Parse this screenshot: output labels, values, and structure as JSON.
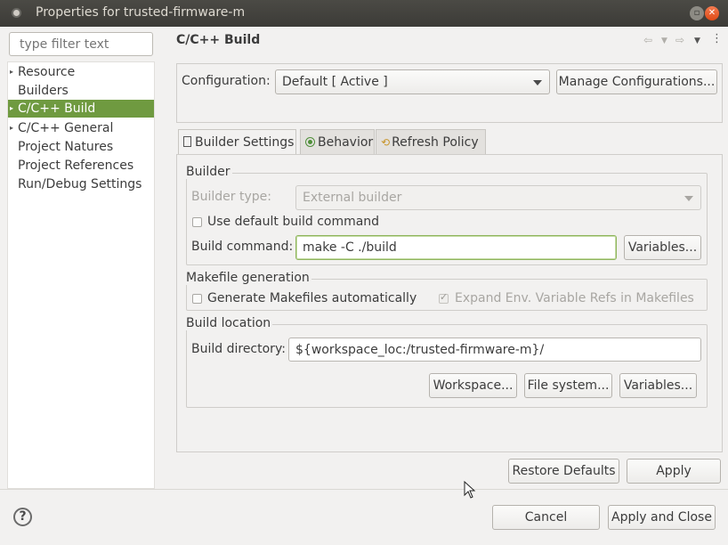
{
  "window": {
    "title": "Properties for trusted-firmware-m"
  },
  "filter": {
    "placeholder": "type filter text"
  },
  "tree": {
    "items": [
      {
        "label": "Resource",
        "expandable": true,
        "selected": false
      },
      {
        "label": "Builders",
        "expandable": false,
        "selected": false
      },
      {
        "label": "C/C++ Build",
        "expandable": true,
        "selected": true
      },
      {
        "label": "C/C++ General",
        "expandable": true,
        "selected": false
      },
      {
        "label": "Project Natures",
        "expandable": false,
        "selected": false
      },
      {
        "label": "Project References",
        "expandable": false,
        "selected": false
      },
      {
        "label": "Run/Debug Settings",
        "expandable": false,
        "selected": false
      }
    ]
  },
  "page": {
    "heading": "C/C++ Build"
  },
  "configuration": {
    "label": "Configuration:",
    "value": "Default  [ Active ]",
    "manage_button": "Manage Configurations..."
  },
  "tabs": [
    {
      "label": "Builder Settings",
      "icon": "document-icon",
      "active": true
    },
    {
      "label": "Behavior",
      "icon": "radio-target-icon",
      "active": false
    },
    {
      "label": "Refresh Policy",
      "icon": "refresh-icon",
      "active": false
    }
  ],
  "builder": {
    "group_label": "Builder",
    "type_label": "Builder type:",
    "type_value": "External builder",
    "use_default_label": "Use default build command",
    "use_default_checked": false,
    "command_label": "Build command:",
    "command_value": "make -C ./build",
    "variables_button": "Variables..."
  },
  "makefile": {
    "group_label": "Makefile generation",
    "generate_label": "Generate Makefiles automatically",
    "generate_checked": false,
    "expand_label": "Expand Env. Variable Refs in Makefiles",
    "expand_checked": true
  },
  "location": {
    "group_label": "Build location",
    "directory_label": "Build directory:",
    "directory_value": "${workspace_loc:/trusted-firmware-m}/",
    "workspace_button": "Workspace...",
    "filesystem_button": "File system...",
    "variables_button": "Variables..."
  },
  "actions": {
    "restore_defaults": "Restore Defaults",
    "apply": "Apply",
    "cancel": "Cancel",
    "apply_close": "Apply and Close",
    "help": "?"
  },
  "colors": {
    "selection": "#6f9a40",
    "focus_border": "#8fb55e",
    "close_button": "#df4a16"
  }
}
